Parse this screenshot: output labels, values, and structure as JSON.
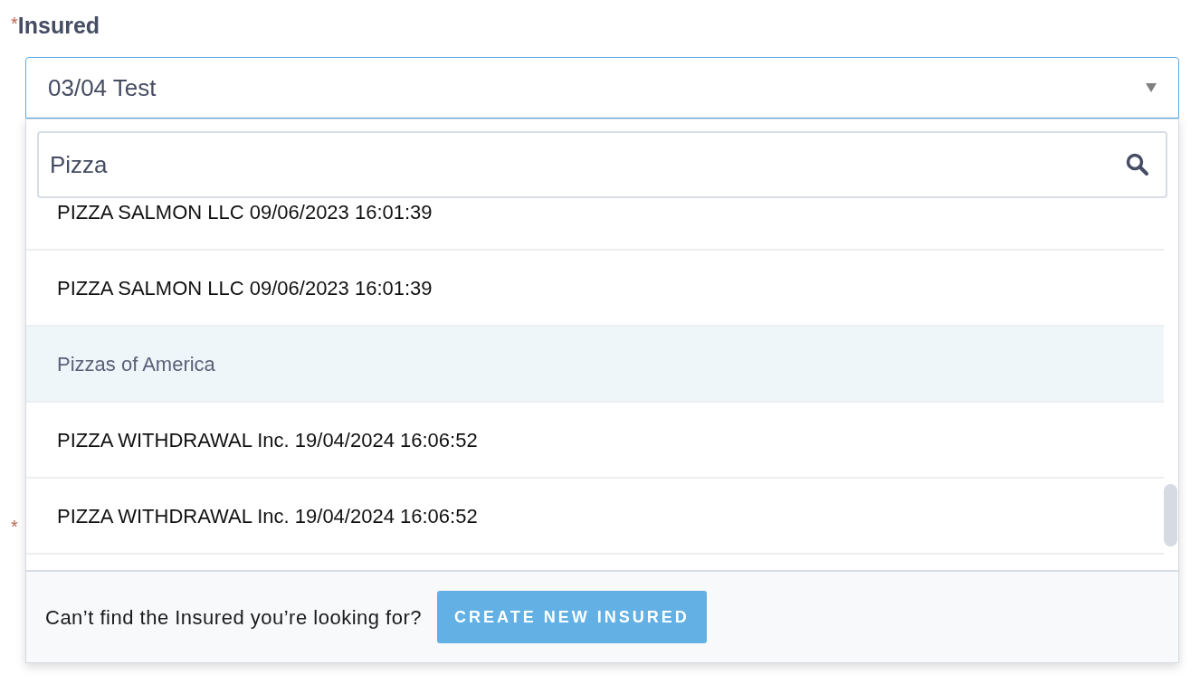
{
  "field": {
    "label": "Insured",
    "required_mark": "*",
    "value": "03/04 Test"
  },
  "search": {
    "value": "Pizza"
  },
  "options": [
    {
      "label": "PIZZA SALMON LLC 09/06/2023 16:01:39",
      "selected": false
    },
    {
      "label": "PIZZA SALMON LLC 09/06/2023 16:01:39",
      "selected": false
    },
    {
      "label": "Pizzas of America",
      "selected": true
    },
    {
      "label": "PIZZA WITHDRAWAL Inc. 19/04/2024 16:06:52",
      "selected": false
    },
    {
      "label": "PIZZA WITHDRAWAL Inc. 19/04/2024 16:06:52",
      "selected": false
    }
  ],
  "footer": {
    "prompt": "Can’t find the Insured you’re looking for?",
    "button": "CREATE NEW INSURED"
  },
  "next_field": {
    "required_mark": "*"
  }
}
